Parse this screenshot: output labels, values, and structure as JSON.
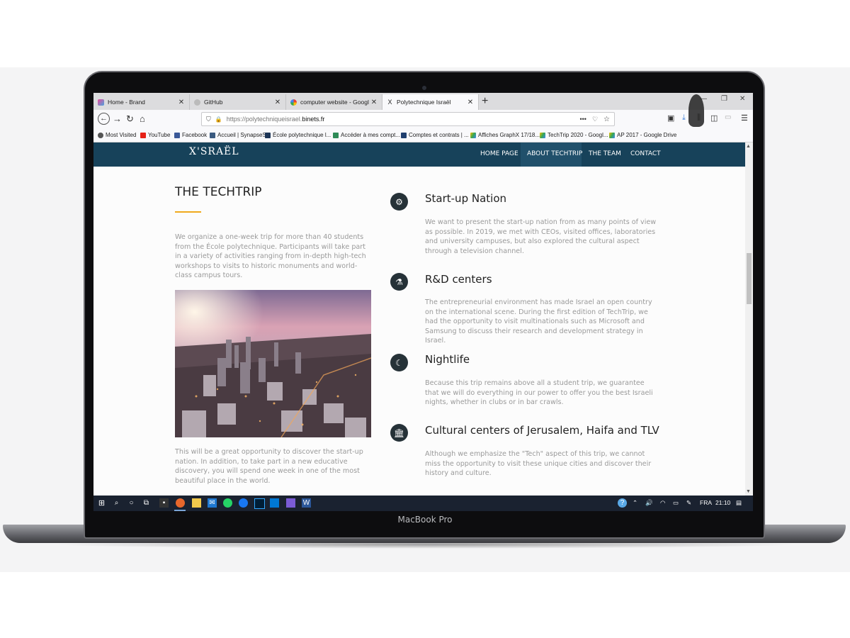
{
  "browser": {
    "tabs": [
      {
        "title": "Home - Brand",
        "icon": "brand-favicon"
      },
      {
        "title": "GitHub",
        "icon": "github-favicon"
      },
      {
        "title": "computer website - Google Se",
        "icon": "google-favicon"
      },
      {
        "title": "Polytechnique Israël",
        "icon": "x-israel-favicon",
        "active": true
      }
    ],
    "url_prefix": "https://polytechniqueisrael.",
    "url_domain": "binets.fr",
    "bookmarks": [
      {
        "label": "Most Visited",
        "icon": "gear-icon"
      },
      {
        "label": "YouTube",
        "icon": "youtube-icon"
      },
      {
        "label": "Facebook",
        "icon": "facebook-icon"
      },
      {
        "label": "Accueil | SynapseS",
        "icon": "synapses-icon"
      },
      {
        "label": "École polytechnique l...",
        "icon": "x-icon"
      },
      {
        "label": "Accéder à mes compt...",
        "icon": "bank-icon"
      },
      {
        "label": "Comptes et contrats | ...",
        "icon": "card-icon"
      },
      {
        "label": "Affiches GraphX 17/18...",
        "icon": "drive-icon"
      },
      {
        "label": "TechTrip 2020 - Googl...",
        "icon": "drive-icon"
      },
      {
        "label": "AP 2017 - Google Drive",
        "icon": "drive-icon"
      }
    ]
  },
  "site": {
    "logo": "X'SRAËL",
    "nav": [
      "HOME PAGE",
      "ABOUT TECHTRIP",
      "THE TEAM",
      "CONTACT"
    ],
    "section_title": "THE TECHTRIP",
    "intro": "We organize a one-week trip for more than 40 students from the École polytechnique. Participants will take part in a variety of activities ranging from in-depth high-tech workshops to visits to historic monuments and world-class campus tours.",
    "outro": "This will be a great opportunity to discover the start-up nation. In addition, to take part in a new educative discovery, you will spend one week in one of the most beautiful place in the world.",
    "features": [
      {
        "title": "Start-up Nation",
        "icon": "gears-icon",
        "body": "We want to present the start-up nation from as many points of view as possible. In 2019, we met with CEOs, visited offices, laboratories and university campuses, but also explored the cultural aspect through a television channel."
      },
      {
        "title": "R&D centers",
        "icon": "flask-icon",
        "body": "The entrepreneurial environment has made Israel an open country on the international scene. During the first edition of TechTrip, we had the opportunity to visit multinationals such as Microsoft and Samsung to discuss their research and development strategy in Israel."
      },
      {
        "title": "Nightlife",
        "icon": "moon-icon",
        "body": "Because this trip remains above all a student trip, we guarantee that we will do everything in our power to offer you the best Israeli nights, whether in clubs or in bar crawls."
      },
      {
        "title": "Cultural centers of Jerusalem, Haifa and TLV",
        "icon": "museum-icon",
        "body": "Although we emphasize the \"Tech\" aspect of this trip, we cannot miss the opportunity to visit these unique cities and discover their history and culture."
      }
    ]
  },
  "taskbar": {
    "language": "FRA",
    "time": "21:10"
  },
  "device": {
    "label": "MacBook Pro"
  },
  "colors": {
    "site_nav": "#17425a",
    "accent": "#f0a91d",
    "taskbar": "#1a2230"
  }
}
